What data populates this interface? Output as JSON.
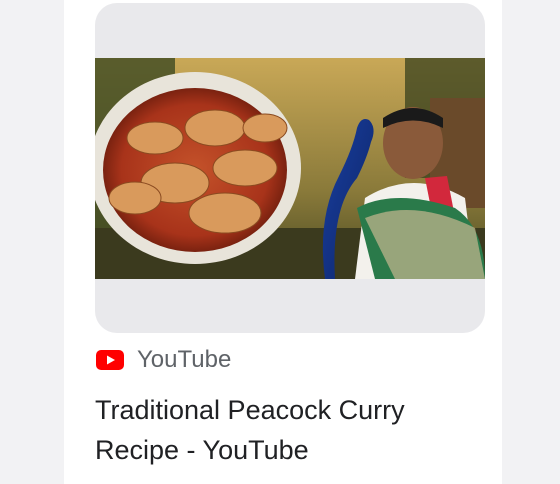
{
  "result": {
    "thumbnail_icon": "video-thumbnail-image",
    "source": {
      "icon": "youtube-logo-icon",
      "name": "YouTube",
      "brand_color": "#ff0000"
    },
    "title": "Traditional Peacock Curry Recipe - YouTube"
  }
}
